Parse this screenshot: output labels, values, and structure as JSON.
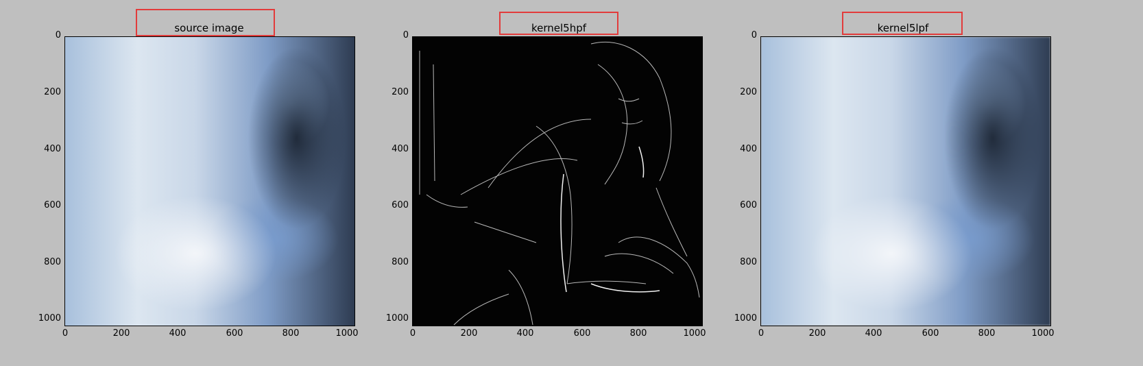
{
  "panels": [
    {
      "title": "source image"
    },
    {
      "title": "kernel5hpf"
    },
    {
      "title": "kernel5lpf"
    }
  ],
  "axes": {
    "y_ticks": [
      "0",
      "200",
      "400",
      "600",
      "800",
      "1000"
    ],
    "x_ticks": [
      "0",
      "200",
      "400",
      "600",
      "800",
      "1000"
    ]
  },
  "colors": {
    "background": "#bfbfbf",
    "highlight": "#e23b3b"
  }
}
